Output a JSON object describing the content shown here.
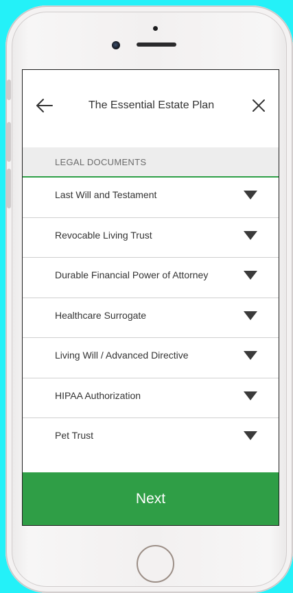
{
  "header": {
    "title": "The Essential Estate Plan",
    "back_icon": "arrow-left-icon",
    "close_icon": "close-icon"
  },
  "section": {
    "label": "LEGAL DOCUMENTS"
  },
  "documents": [
    {
      "label": "Last Will and Testament"
    },
    {
      "label": "Revocable Living Trust"
    },
    {
      "label": "Durable Financial Power of Attorney"
    },
    {
      "label": "Healthcare Surrogate"
    },
    {
      "label": "Living Will / Advanced Directive"
    },
    {
      "label": "HIPAA Authorization"
    },
    {
      "label": "Pet Trust"
    }
  ],
  "footer": {
    "next_label": "Next"
  },
  "colors": {
    "accent": "#2f9e46",
    "background": "#24f1f8",
    "section_bg": "#ededed"
  }
}
